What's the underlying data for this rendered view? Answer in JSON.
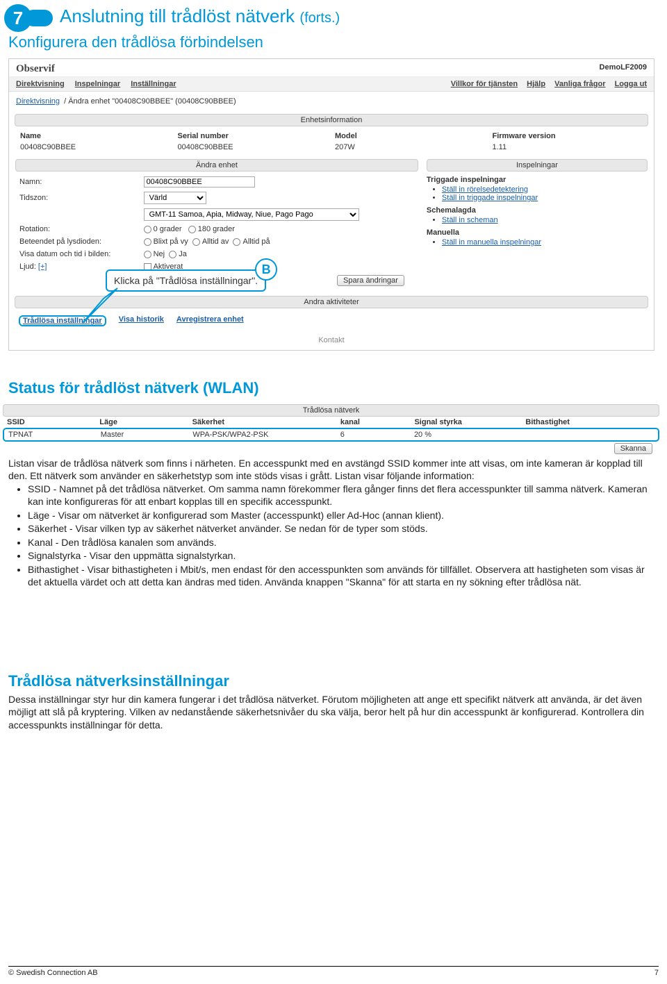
{
  "step_number": "7",
  "page_title": "Anslutning till trådlöst nätverk",
  "page_title_suffix": "(forts.)",
  "subtitle": "Konfigurera den trådlösa förbindelsen",
  "callout_b": {
    "letter": "B",
    "text": "Klicka på \"Trådlösa inställningar\"."
  },
  "screenshot": {
    "logo": "Observif",
    "user": "DemoLF2009",
    "nav_left": [
      "Direktvisning",
      "Inspelningar",
      "Inställningar"
    ],
    "nav_right": [
      "Villkor för tjänsten",
      "Hjälp",
      "Vanliga frågor",
      "Logga ut"
    ],
    "breadcrumb_link": "Direktvisning",
    "breadcrumb_rest": "Ändra enhet \"00408C90BBEE\" (00408C90BBEE)",
    "section_info_title": "Enhetsinformation",
    "info_headers": [
      "Name",
      "Serial number",
      "Model",
      "Firmware version"
    ],
    "info_values": [
      "00408C90BBEE",
      "00408C90BBEE",
      "207W",
      "1.11"
    ],
    "edit_title": "Ändra enhet",
    "inspel_title": "Inspelningar",
    "edit": {
      "labels": {
        "name": "Namn:",
        "timezone": "Tidszon:",
        "rotation": "Rotation:",
        "led": "Beteendet på lysdioden:",
        "showdt": "Visa datum och tid i bilden:",
        "sound": "Ljud:"
      },
      "name_value": "00408C90BBEE",
      "tz_select1": "Värld",
      "tz_select2": "GMT-11 Samoa, Apia, Midway, Niue, Pago Pago",
      "rotation_opts": [
        "0 grader",
        "180 grader"
      ],
      "led_opts": [
        "Blixt på vy",
        "Alltid av",
        "Alltid på"
      ],
      "showdt_opts": [
        "Nej",
        "Ja"
      ],
      "sound_link": "[+]",
      "sound_opt": "Aktiverat",
      "save_btn": "Spara ändringar"
    },
    "inspel": {
      "g1": "Triggade inspelningar",
      "g1_links": [
        "Ställ in rörelsedetektering",
        "Ställ in triggade inspelningar"
      ],
      "g2": "Schemalagda",
      "g2_links": [
        "Ställ in scheman"
      ],
      "g3": "Manuella",
      "g3_links": [
        "Ställ in manuella inspelningar"
      ]
    },
    "activities_title": "Andra aktiviteter",
    "activities": [
      "Trådlösa inställningar",
      "Visa historik",
      "Avregistrera enhet"
    ],
    "contact": "Kontakt"
  },
  "status_heading": "Status för trådlöst nätverk (WLAN)",
  "wlan_table": {
    "title": "Trådlösa nätverk",
    "headers": [
      "SSID",
      "Läge",
      "Säkerhet",
      "kanal",
      "Signal styrka",
      "Bithastighet"
    ],
    "row": [
      "TPNAT",
      "Master",
      "WPA-PSK/WPA2-PSK",
      "6",
      "20 %",
      ""
    ],
    "scan_btn": "Skanna"
  },
  "body_intro": "Listan visar de trådlösa nätverk som finns i närheten. En accesspunkt med en avstängd SSID kommer inte att visas, om inte kameran är kopplad till den. Ett nätverk som använder en säkerhetstyp som inte stöds visas i grått. Listan visar följande information:",
  "body_bullets": [
    "SSID - Namnet på det trådlösa nätverket. Om samma namn förekommer flera gånger finns det flera accesspunkter till samma nätverk. Kameran kan inte konfigureras för att enbart kopplas till en specifik accesspunkt.",
    "Läge - Visar om nätverket är konfigurerad som Master (accesspunkt) eller Ad-Hoc (annan klient).",
    "Säkerhet - Visar vilken typ av säkerhet nätverket använder. Se nedan för de typer som stöds.",
    "Kanal - Den trådlösa kanalen som används.",
    "Signalstyrka - Visar den uppmätta signalstyrkan.",
    "Bithastighet - Visar bithastigheten i Mbit/s, men endast för den accesspunkten som används för tillfället. Observera att hastigheten som visas är det aktuella värdet och att detta kan ändras med tiden. Använda knappen \"Skanna\" för att starta en ny sökning efter trådlösa nät."
  ],
  "settings_heading": "Trådlösa nätverksinställningar",
  "settings_text": "Dessa inställningar styr hur din kamera fungerar i det trådlösa nätverket. Förutom möjligheten att ange ett specifikt nätverk att använda, är det även möjligt att slå på kryptering. Vilken av nedanstående säkerhetsnivåer du ska välja, beror helt på hur din accesspunkt är konfigurerad. Kontrollera din accesspunkts inställningar för detta.",
  "footer_left": "© Swedish Connection AB",
  "footer_right": "7"
}
